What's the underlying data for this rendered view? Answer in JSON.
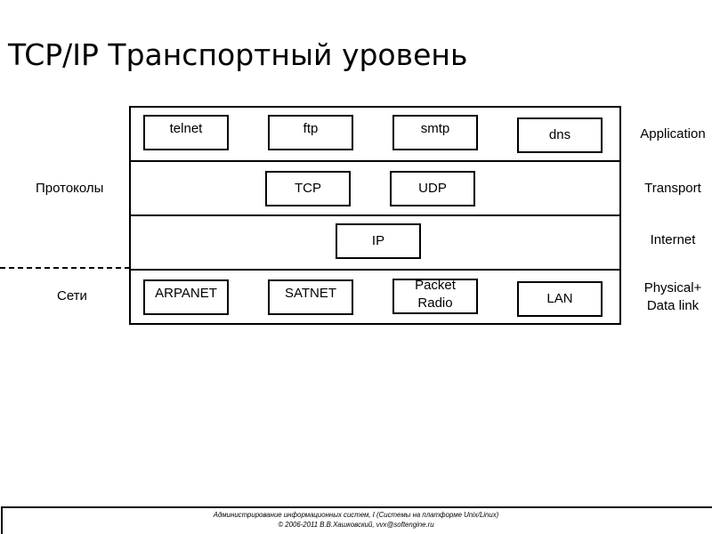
{
  "title": "TCP/IP Транспортный уровень",
  "diagram": {
    "left_labels": {
      "protocols": "Протоколы",
      "networks": "Сети"
    },
    "layers": [
      {
        "name": "Application",
        "boxes": [
          "telnet",
          "ftp",
          "smtp",
          "dns"
        ]
      },
      {
        "name": "Transport",
        "boxes": [
          "TCP",
          "UDP"
        ]
      },
      {
        "name": "Internet",
        "boxes": [
          "IP"
        ]
      },
      {
        "name_line1": "Physical+",
        "name_line2": "Data link",
        "boxes": [
          "ARPANET",
          "SATNET",
          "Packet",
          "Radio",
          "LAN"
        ]
      }
    ]
  },
  "footer": {
    "line1": "Администрирование информационных систем, I (Системы на платформе Unix/Linux)",
    "line2": "© 2006-2011 В.В.Хашковский, vvx@softengine.ru"
  }
}
